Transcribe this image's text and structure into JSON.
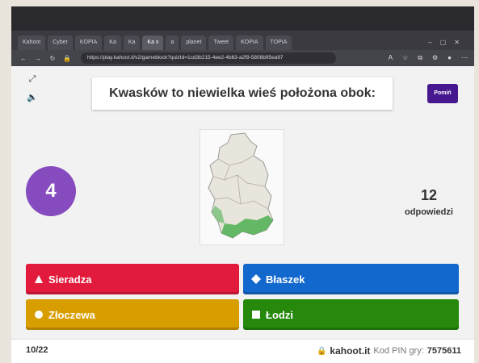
{
  "browser": {
    "tabs": [
      "Kahoot",
      "Cyber",
      "KOPIA",
      "Ka",
      "Ka",
      "Ka x",
      "a",
      "planet",
      "Tweet",
      "KOPIA",
      "TOPIA"
    ],
    "url": "https://play.kahoot.it/v2/gameblock?quizId=1cd3b215-4ee2-4b63-a2f9-5808b95ea97"
  },
  "question": {
    "text": "Kwasków to niewielka wieś położona obok:"
  },
  "skip_button": "Pomiń",
  "timer": "4",
  "answers_count": {
    "number": "12",
    "label": "odpowiedzi"
  },
  "answers": [
    {
      "label": "Sieradza",
      "shape": "triangle-icon",
      "color": "#e21b3c"
    },
    {
      "label": "Błaszek",
      "shape": "diamond-icon",
      "color": "#1368ce"
    },
    {
      "label": "Złoczewa",
      "shape": "circle-icon",
      "color": "#d89e00"
    },
    {
      "label": "Łodzi",
      "shape": "square-icon",
      "color": "#26890c"
    }
  ],
  "footer": {
    "progress": "10/22",
    "site": "kahoot.it",
    "pin_label": "Kod PIN gry:",
    "pin": "7575611"
  }
}
